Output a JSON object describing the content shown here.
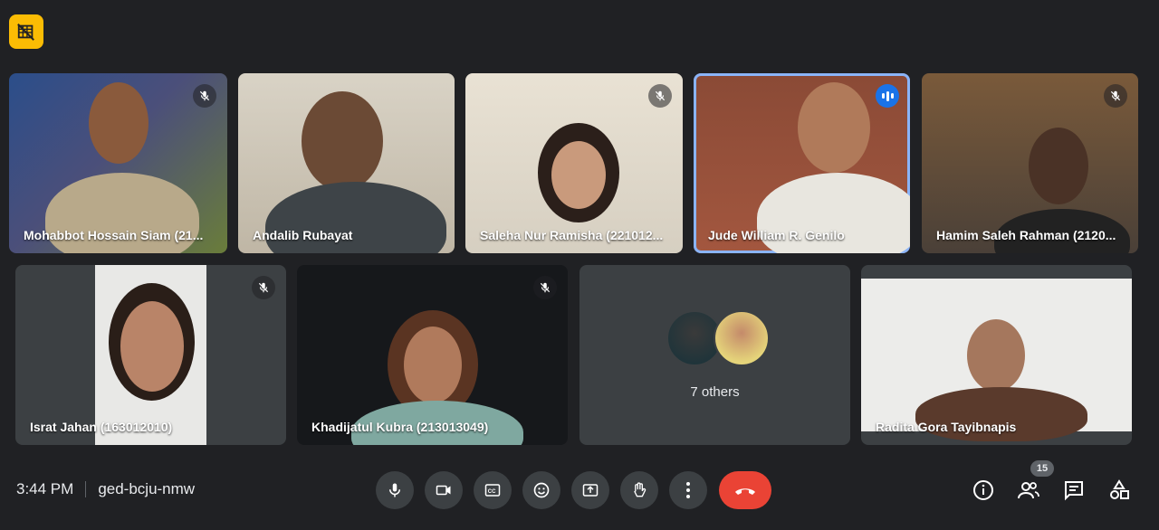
{
  "participants_row1": [
    {
      "name": "Mohabbot Hossain Siam (21...",
      "muted": true
    },
    {
      "name": "Andalib Rubayat",
      "muted": false
    },
    {
      "name": "Saleha Nur Ramisha (221012...",
      "muted": true
    },
    {
      "name": "Jude William R. Genilo",
      "muted": false,
      "speaking": true
    },
    {
      "name": "Hamim Saleh Rahman (2120...",
      "muted": true
    }
  ],
  "participants_row2": [
    {
      "name": "Israt Jahan (163012010)",
      "muted": true
    },
    {
      "name": "Khadijatul Kubra (213013049)",
      "muted": true
    },
    {
      "others_label": "7 others"
    },
    {
      "name": "Radita Gora Tayibnapis",
      "muted": false
    }
  ],
  "meeting": {
    "time": "3:44 PM",
    "code": "ged-bcju-nmw"
  },
  "people_count": "15",
  "colors": {
    "background": "#202124",
    "tile": "#3c4043",
    "end_call": "#ea4335",
    "active_border": "#8ab4f8",
    "speaking": "#1a73e8",
    "badge": "#fbbc04"
  }
}
